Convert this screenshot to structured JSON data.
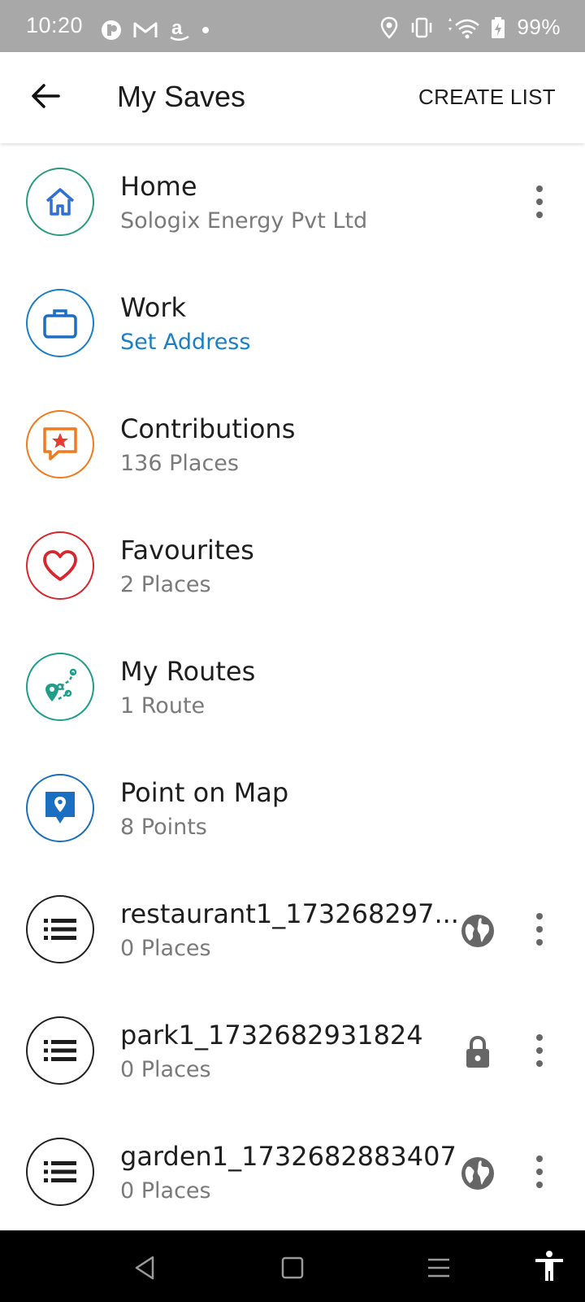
{
  "status_bar": {
    "time": "10:20",
    "battery": "99%",
    "left_icons": [
      "notification-app-icon",
      "gmail-icon",
      "amazon-icon",
      "dot-icon"
    ],
    "right_icons": [
      "location-icon",
      "vibrate-icon",
      "data-arrows-icon",
      "wifi-icon",
      "battery-charging-icon"
    ]
  },
  "appbar": {
    "title": "My Saves",
    "create_list": "CREATE LIST"
  },
  "items": [
    {
      "title": "Home",
      "subtitle": "Sologix Energy Pvt Ltd",
      "icon": "home-icon",
      "color": "#2e9b7f",
      "has_menu": true
    },
    {
      "title": "Work",
      "subtitle": "Set Address",
      "icon": "briefcase-icon",
      "color": "#1a7fc4",
      "has_menu": false
    },
    {
      "title": "Contributions",
      "subtitle": "136 Places",
      "icon": "contribution-star-icon",
      "color": "#f07a1e",
      "has_menu": false
    },
    {
      "title": "Favourites",
      "subtitle": "2 Places",
      "icon": "heart-icon",
      "color": "#d9262d",
      "has_menu": false
    },
    {
      "title": "My Routes",
      "subtitle": "1 Route",
      "icon": "route-icon",
      "color": "#1f9e8a",
      "has_menu": false
    },
    {
      "title": "Point on Map",
      "subtitle": "8 Points",
      "icon": "map-pin-icon",
      "color": "#1b6fc2",
      "has_menu": false
    },
    {
      "title": "restaurant1_173268297...",
      "subtitle": "0 Places",
      "icon": "list-icon",
      "color": "#222222",
      "privacy": "globe-icon",
      "has_menu": true
    },
    {
      "title": "park1_1732682931824",
      "subtitle": "0 Places",
      "icon": "list-icon",
      "color": "#222222",
      "privacy": "lock-icon",
      "has_menu": true
    },
    {
      "title": "garden1_1732682883407",
      "subtitle": "0 Places",
      "icon": "list-icon",
      "color": "#222222",
      "privacy": "globe-icon",
      "has_menu": true
    }
  ],
  "nav_bar": [
    "back-nav-icon",
    "home-nav-icon",
    "recents-nav-icon",
    "accessibility-icon"
  ]
}
